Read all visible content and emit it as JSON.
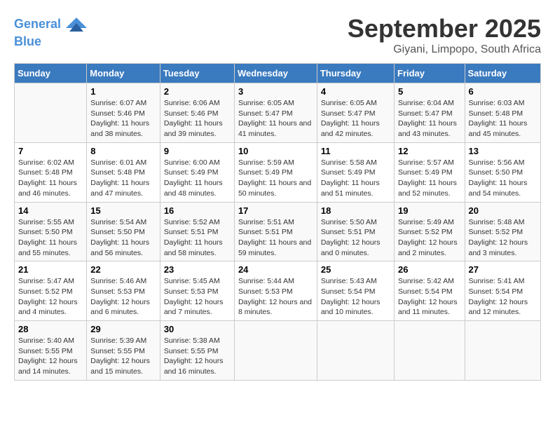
{
  "header": {
    "logo_line1": "General",
    "logo_line2": "Blue",
    "month": "September 2025",
    "location": "Giyani, Limpopo, South Africa"
  },
  "weekdays": [
    "Sunday",
    "Monday",
    "Tuesday",
    "Wednesday",
    "Thursday",
    "Friday",
    "Saturday"
  ],
  "weeks": [
    [
      {
        "day": "",
        "sunrise": "",
        "sunset": "",
        "daylight": ""
      },
      {
        "day": "1",
        "sunrise": "Sunrise: 6:07 AM",
        "sunset": "Sunset: 5:46 PM",
        "daylight": "Daylight: 11 hours and 38 minutes."
      },
      {
        "day": "2",
        "sunrise": "Sunrise: 6:06 AM",
        "sunset": "Sunset: 5:46 PM",
        "daylight": "Daylight: 11 hours and 39 minutes."
      },
      {
        "day": "3",
        "sunrise": "Sunrise: 6:05 AM",
        "sunset": "Sunset: 5:47 PM",
        "daylight": "Daylight: 11 hours and 41 minutes."
      },
      {
        "day": "4",
        "sunrise": "Sunrise: 6:05 AM",
        "sunset": "Sunset: 5:47 PM",
        "daylight": "Daylight: 11 hours and 42 minutes."
      },
      {
        "day": "5",
        "sunrise": "Sunrise: 6:04 AM",
        "sunset": "Sunset: 5:47 PM",
        "daylight": "Daylight: 11 hours and 43 minutes."
      },
      {
        "day": "6",
        "sunrise": "Sunrise: 6:03 AM",
        "sunset": "Sunset: 5:48 PM",
        "daylight": "Daylight: 11 hours and 45 minutes."
      }
    ],
    [
      {
        "day": "7",
        "sunrise": "Sunrise: 6:02 AM",
        "sunset": "Sunset: 5:48 PM",
        "daylight": "Daylight: 11 hours and 46 minutes."
      },
      {
        "day": "8",
        "sunrise": "Sunrise: 6:01 AM",
        "sunset": "Sunset: 5:48 PM",
        "daylight": "Daylight: 11 hours and 47 minutes."
      },
      {
        "day": "9",
        "sunrise": "Sunrise: 6:00 AM",
        "sunset": "Sunset: 5:49 PM",
        "daylight": "Daylight: 11 hours and 48 minutes."
      },
      {
        "day": "10",
        "sunrise": "Sunrise: 5:59 AM",
        "sunset": "Sunset: 5:49 PM",
        "daylight": "Daylight: 11 hours and 50 minutes."
      },
      {
        "day": "11",
        "sunrise": "Sunrise: 5:58 AM",
        "sunset": "Sunset: 5:49 PM",
        "daylight": "Daylight: 11 hours and 51 minutes."
      },
      {
        "day": "12",
        "sunrise": "Sunrise: 5:57 AM",
        "sunset": "Sunset: 5:49 PM",
        "daylight": "Daylight: 11 hours and 52 minutes."
      },
      {
        "day": "13",
        "sunrise": "Sunrise: 5:56 AM",
        "sunset": "Sunset: 5:50 PM",
        "daylight": "Daylight: 11 hours and 54 minutes."
      }
    ],
    [
      {
        "day": "14",
        "sunrise": "Sunrise: 5:55 AM",
        "sunset": "Sunset: 5:50 PM",
        "daylight": "Daylight: 11 hours and 55 minutes."
      },
      {
        "day": "15",
        "sunrise": "Sunrise: 5:54 AM",
        "sunset": "Sunset: 5:50 PM",
        "daylight": "Daylight: 11 hours and 56 minutes."
      },
      {
        "day": "16",
        "sunrise": "Sunrise: 5:52 AM",
        "sunset": "Sunset: 5:51 PM",
        "daylight": "Daylight: 11 hours and 58 minutes."
      },
      {
        "day": "17",
        "sunrise": "Sunrise: 5:51 AM",
        "sunset": "Sunset: 5:51 PM",
        "daylight": "Daylight: 11 hours and 59 minutes."
      },
      {
        "day": "18",
        "sunrise": "Sunrise: 5:50 AM",
        "sunset": "Sunset: 5:51 PM",
        "daylight": "Daylight: 12 hours and 0 minutes."
      },
      {
        "day": "19",
        "sunrise": "Sunrise: 5:49 AM",
        "sunset": "Sunset: 5:52 PM",
        "daylight": "Daylight: 12 hours and 2 minutes."
      },
      {
        "day": "20",
        "sunrise": "Sunrise: 5:48 AM",
        "sunset": "Sunset: 5:52 PM",
        "daylight": "Daylight: 12 hours and 3 minutes."
      }
    ],
    [
      {
        "day": "21",
        "sunrise": "Sunrise: 5:47 AM",
        "sunset": "Sunset: 5:52 PM",
        "daylight": "Daylight: 12 hours and 4 minutes."
      },
      {
        "day": "22",
        "sunrise": "Sunrise: 5:46 AM",
        "sunset": "Sunset: 5:53 PM",
        "daylight": "Daylight: 12 hours and 6 minutes."
      },
      {
        "day": "23",
        "sunrise": "Sunrise: 5:45 AM",
        "sunset": "Sunset: 5:53 PM",
        "daylight": "Daylight: 12 hours and 7 minutes."
      },
      {
        "day": "24",
        "sunrise": "Sunrise: 5:44 AM",
        "sunset": "Sunset: 5:53 PM",
        "daylight": "Daylight: 12 hours and 8 minutes."
      },
      {
        "day": "25",
        "sunrise": "Sunrise: 5:43 AM",
        "sunset": "Sunset: 5:54 PM",
        "daylight": "Daylight: 12 hours and 10 minutes."
      },
      {
        "day": "26",
        "sunrise": "Sunrise: 5:42 AM",
        "sunset": "Sunset: 5:54 PM",
        "daylight": "Daylight: 12 hours and 11 minutes."
      },
      {
        "day": "27",
        "sunrise": "Sunrise: 5:41 AM",
        "sunset": "Sunset: 5:54 PM",
        "daylight": "Daylight: 12 hours and 12 minutes."
      }
    ],
    [
      {
        "day": "28",
        "sunrise": "Sunrise: 5:40 AM",
        "sunset": "Sunset: 5:55 PM",
        "daylight": "Daylight: 12 hours and 14 minutes."
      },
      {
        "day": "29",
        "sunrise": "Sunrise: 5:39 AM",
        "sunset": "Sunset: 5:55 PM",
        "daylight": "Daylight: 12 hours and 15 minutes."
      },
      {
        "day": "30",
        "sunrise": "Sunrise: 5:38 AM",
        "sunset": "Sunset: 5:55 PM",
        "daylight": "Daylight: 12 hours and 16 minutes."
      },
      {
        "day": "",
        "sunrise": "",
        "sunset": "",
        "daylight": ""
      },
      {
        "day": "",
        "sunrise": "",
        "sunset": "",
        "daylight": ""
      },
      {
        "day": "",
        "sunrise": "",
        "sunset": "",
        "daylight": ""
      },
      {
        "day": "",
        "sunrise": "",
        "sunset": "",
        "daylight": ""
      }
    ]
  ]
}
